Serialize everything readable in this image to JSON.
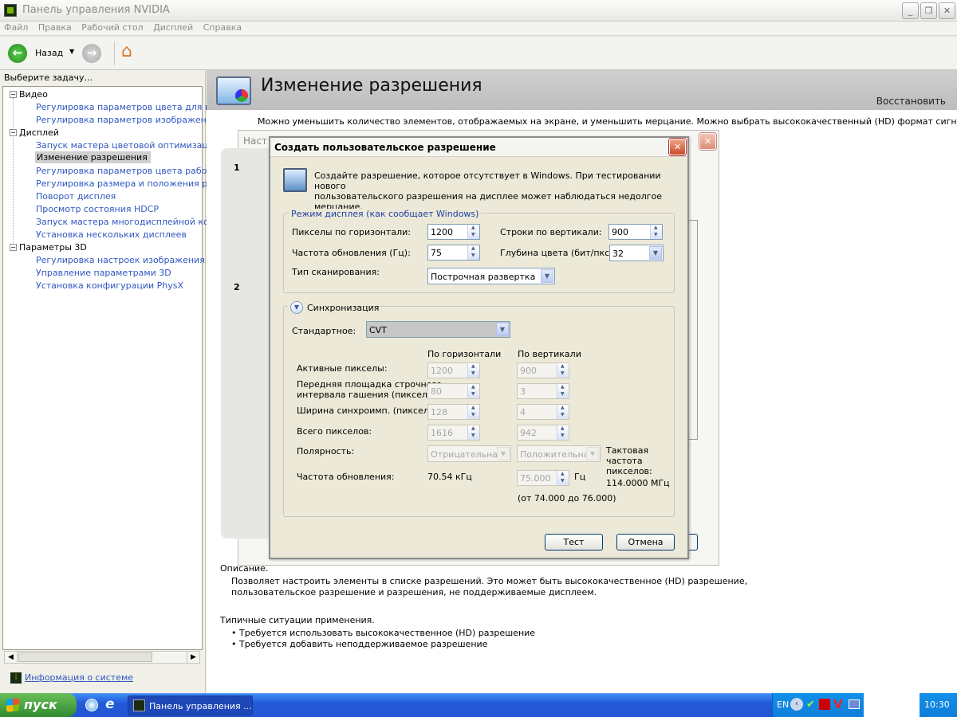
{
  "window": {
    "title": "Панель управления NVIDIA"
  },
  "menu": [
    "Файл",
    "Правка",
    "Рабочий стол",
    "Дисплей",
    "Справка"
  ],
  "toolbar": {
    "back_label": "Назад"
  },
  "left": {
    "heading": "Выберите задачу...",
    "tree": [
      {
        "label": "Видео",
        "kind": "group"
      },
      {
        "label": "Регулировка параметров цвета для вид",
        "kind": "leaf"
      },
      {
        "label": "Регулировка параметров изображения д",
        "kind": "leaf"
      },
      {
        "label": "Дисплей",
        "kind": "group"
      },
      {
        "label": "Запуск мастера цветовой оптимизации",
        "kind": "leaf"
      },
      {
        "label": "Изменение разрешения",
        "kind": "leaf-selected"
      },
      {
        "label": "Регулировка параметров цвета рабочег",
        "kind": "leaf"
      },
      {
        "label": "Регулировка размера и положения рабо",
        "kind": "leaf"
      },
      {
        "label": "Поворот дисплея",
        "kind": "leaf"
      },
      {
        "label": "Просмотр состояния HDCP",
        "kind": "leaf"
      },
      {
        "label": "Запуск мастера многодисплейной конфи",
        "kind": "leaf"
      },
      {
        "label": "Установка нескольких дисплеев",
        "kind": "leaf"
      },
      {
        "label": "Параметры 3D",
        "kind": "group"
      },
      {
        "label": "Регулировка настроек изображения с пр",
        "kind": "leaf"
      },
      {
        "label": "Управление параметрами 3D",
        "kind": "leaf"
      },
      {
        "label": "Установка конфигурации PhysX",
        "kind": "leaf"
      }
    ],
    "sysinfo": "Информация о системе"
  },
  "main": {
    "title": "Изменение разрешения",
    "restore": "Восстановить",
    "intro": "Можно уменьшить количество элементов, отображаемых на экране, и уменьшить мерцание. Можно выбрать высококачественный (HD) формат сигнала, если",
    "back_dialog_title": "Наст",
    "step1": "1",
    "step2": "2",
    "description_heading": "Описание.",
    "description": [
      "Позволяет настроить элементы в списке разрешений. Это может быть высококачественное (HD) разрешение,",
      "пользовательское разрешение и разрешения, не поддерживаемые дисплеем."
    ],
    "usage_heading": "Типичные ситуации применения.",
    "usage": [
      "Требуется использовать высококачественное (HD) разрешение",
      "Требуется добавить неподдерживаемое разрешение"
    ]
  },
  "dialog": {
    "title": "Создать пользовательское разрешение",
    "info": [
      "Создайте разрешение, которое отсутствует в Windows. При тестировании нового",
      "пользовательского разрешения на дисплее может наблюдаться недолгое",
      "мерцание."
    ],
    "mode_group": "Режим дисплея (как сообщает Windows)",
    "h_pixels_label": "Пикселы по горизонтали:",
    "h_pixels": "1200",
    "v_lines_label": "Строки по вертикали:",
    "v_lines": "900",
    "refresh_label": "Частота обновления (Гц):",
    "refresh": "75",
    "depth_label": "Глубина цвета (бит/пкс):",
    "depth": "32",
    "scan_label": "Тип сканирования:",
    "scan": "Построчная развертка",
    "sync_group": "Синхронизация",
    "standard_label": "Стандартное:",
    "standard": "CVT",
    "col_h": "По горизонтали",
    "col_v": "По вертикали",
    "rows": [
      {
        "label": [
          "Активные пикселы:"
        ],
        "h": "1200",
        "v": "900"
      },
      {
        "label": [
          "Передняя площадка строчного",
          "интервала гашения (пикселы):"
        ],
        "h": "80",
        "v": "3"
      },
      {
        "label": [
          "Ширина синхроимп. (пикселы):"
        ],
        "h": "128",
        "v": "4"
      },
      {
        "label": [
          "Всего пикселов:"
        ],
        "h": "1616",
        "v": "942"
      }
    ],
    "polarity_label": "Полярность:",
    "polarity_h": "Отрицательная",
    "polarity_v": "Положительная",
    "pixel_clock": [
      "Тактовая",
      "частота",
      "пикселов:",
      "114.0000 МГц"
    ],
    "sync_refresh_label": "Частота обновления:",
    "h_freq": "70.54 кГц",
    "v_freq": "75.000",
    "v_freq_unit": "Гц",
    "range": "(от 74.000 до 76.000)",
    "test_button": "Тест",
    "cancel_button": "Отмена"
  },
  "taskbar": {
    "start": "пуск",
    "item": "Панель управления ...",
    "lang": "EN",
    "clock": "10:30"
  }
}
